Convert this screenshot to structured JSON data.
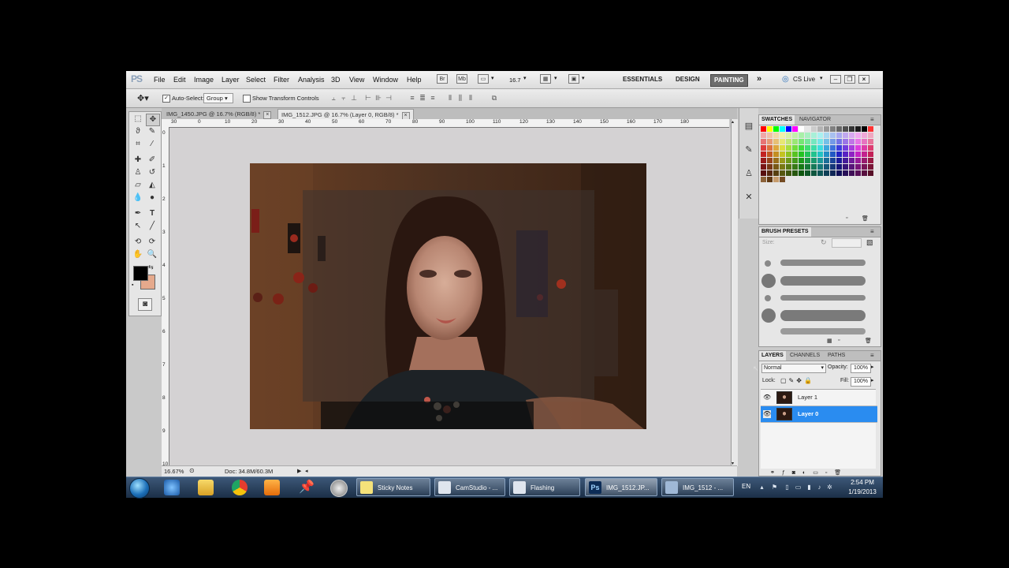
{
  "menubar": {
    "logo": "PS",
    "items": [
      "File",
      "Edit",
      "Image",
      "Layer",
      "Select",
      "Filter",
      "Analysis",
      "3D",
      "View",
      "Window",
      "Help"
    ],
    "zoom": "16.7",
    "workspaces": [
      "ESSENTIALS",
      "DESIGN",
      "PAINTING"
    ],
    "more": "»",
    "cslive": "CS Live"
  },
  "options": {
    "auto_select_label": "Auto-Select:",
    "auto_select_value": "Group",
    "transform_label": "Show Transform Controls"
  },
  "tabs": [
    {
      "title": "IMG_1450.JPG @ 16.7% (RGB/8) *",
      "close": "×"
    },
    {
      "title": "IMG_1512.JPG @ 16.7% (Layer 0, RGB/8) *",
      "close": "×"
    }
  ],
  "ruler": {
    "top": [
      "30",
      "0",
      "10",
      "20",
      "30",
      "40",
      "50",
      "60",
      "70",
      "80",
      "90",
      "100",
      "110",
      "120",
      "130",
      "140",
      "150",
      "160",
      "170",
      "180"
    ],
    "left": [
      "0",
      "1",
      "2",
      "3",
      "4",
      "5",
      "6",
      "7",
      "8",
      "9",
      "10"
    ]
  },
  "status": {
    "zoom": "16.67%",
    "doc": "Doc: 34.8M/60.3M"
  },
  "swatches_panel": {
    "tabs": [
      "SWATCHES",
      "NAVIGATOR"
    ]
  },
  "brush_panel": {
    "title": "BRUSH PRESETS",
    "size_label": "Size:"
  },
  "layers_panel": {
    "tabs": [
      "LAYERS",
      "CHANNELS",
      "PATHS"
    ],
    "blend_mode": "Normal",
    "opacity_label": "Opacity:",
    "opacity": "100%",
    "lock_label": "Lock:",
    "fill_label": "Fill:",
    "fill": "100%",
    "layers": [
      {
        "name": "Layer 1",
        "selected": false
      },
      {
        "name": "Layer 0",
        "selected": true
      }
    ]
  },
  "taskbar": {
    "buttons": [
      {
        "label": "Sticky Notes",
        "active": false
      },
      {
        "label": "CamStudio - ...",
        "active": false
      },
      {
        "label": "Flashing",
        "active": false
      },
      {
        "label": "IMG_1512.JP...",
        "active": true
      },
      {
        "label": "IMG_1512 - ...",
        "active": false
      }
    ],
    "lang": "EN",
    "time": "2:54 PM",
    "date": "1/19/2013"
  },
  "colors": {
    "accent_selection": "#2a8cf0",
    "foreground": "#000000",
    "background": "#e5a98c"
  }
}
